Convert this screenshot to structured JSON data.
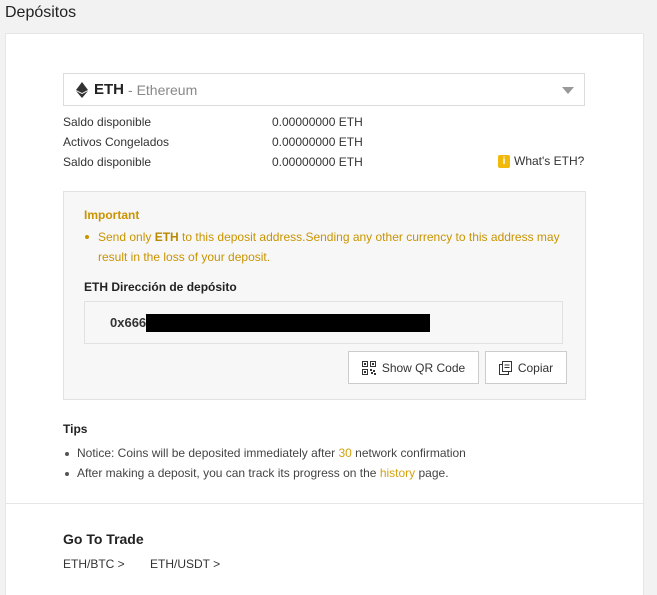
{
  "page": {
    "title": "Depósitos"
  },
  "currency": {
    "code": "ETH",
    "separator": " - ",
    "name": "Ethereum"
  },
  "balances": [
    {
      "label": "Saldo disponible",
      "value": "0.00000000 ETH"
    },
    {
      "label": "Activos Congelados",
      "value": "0.00000000 ETH"
    },
    {
      "label": "Saldo disponible",
      "value": "0.00000000 ETH"
    }
  ],
  "whats_link": {
    "icon": "info-icon",
    "label": "What's ETH?"
  },
  "important": {
    "title": "Important",
    "text_before": "Send only ",
    "text_currency": "ETH",
    "text_after": " to this deposit address.Sending any other currency to this address may result in the loss of your deposit."
  },
  "deposit": {
    "label": "ETH Dirección de depósito",
    "address_visible": "0x666"
  },
  "buttons": {
    "qr": "Show QR Code",
    "copy": "Copiar"
  },
  "tips": {
    "title": "Tips",
    "tip1_before": "Notice: Coins will be deposited immediately after ",
    "tip1_number": "30",
    "tip1_after": " network confirmation",
    "tip2_before": "After making a deposit, you can track its progress on the ",
    "tip2_link": "history",
    "tip2_after": " page."
  },
  "trade": {
    "title": "Go To Trade",
    "pairs": [
      "ETH/BTC >",
      "ETH/USDT >"
    ]
  },
  "colors": {
    "accent": "#c99400",
    "link": "#d4a10f"
  }
}
